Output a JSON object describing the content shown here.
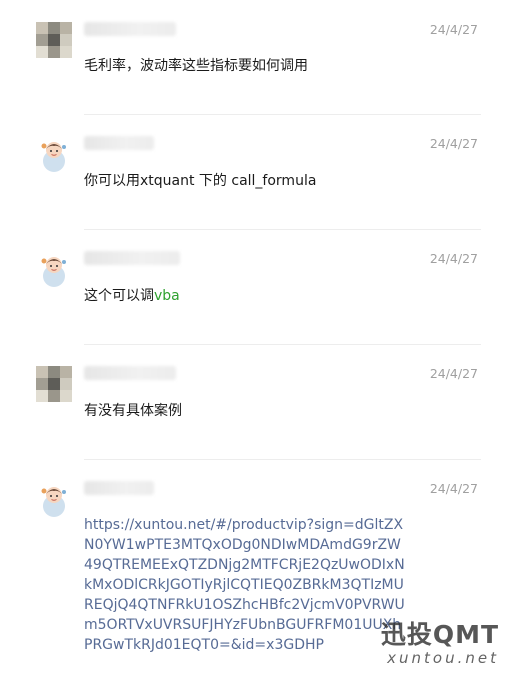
{
  "messages": [
    {
      "sender": "",
      "time": "24/4/27",
      "text": "毛利率，波动率这些指标要如何调用",
      "avatar_icon": "pixelated-avatar"
    },
    {
      "sender": "",
      "time": "24/4/27",
      "text": "你可以用xtquant 下的 call_formula",
      "avatar_icon": "cartoon-avatar"
    },
    {
      "sender": "",
      "time": "24/4/27",
      "text_plain": "这个可以调",
      "text_highlight": "vba",
      "highlight_color": "#2fa12f",
      "avatar_icon": "cartoon-avatar"
    },
    {
      "sender": "",
      "time": "24/4/27",
      "text": "有没有具体案例",
      "avatar_icon": "pixelated-avatar"
    },
    {
      "sender": "",
      "time": "24/4/27",
      "link": "https://xuntou.net/#/productvip?sign=dGltZXN0YW1wPTE3MTQxODg0NDIwMDAmdG9rZW49QTREMEExQTZDNjg2MTFCRjE2QzUwODIxNkMxODlCRkJGOTIyRjlCQTIEQ0ZBRkM3QTIzMUREQjQ4QTNFRkU1OSZhcHBfc2VjcmV0PVRWUm5ORTVxUVRSUFJHYzFUbnBGUFRFM01UUXhPRGwTkRJd01EQT0=&id=x3GDHP",
      "avatar_icon": "cartoon-avatar"
    }
  ],
  "watermark": {
    "brand": "迅投QMT",
    "site": "xuntou.net"
  },
  "colors": {
    "link": "#576b95",
    "timestamp": "#a0a0a0",
    "separator": "#ededed"
  }
}
